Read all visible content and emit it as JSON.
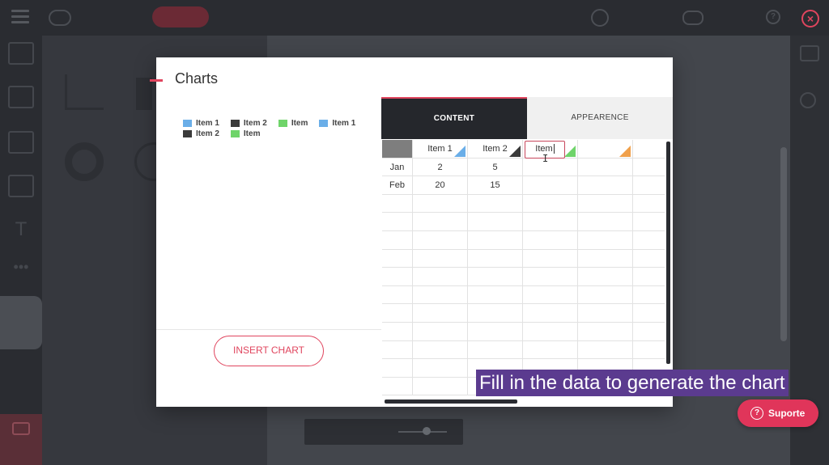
{
  "modal": {
    "title": "Charts",
    "insert_label": "INSERT CHART",
    "tabs": {
      "content": "CONTENT",
      "appearance": "APPEARENCE"
    }
  },
  "legend": [
    {
      "label": "Item 1",
      "color": "#6aaee8"
    },
    {
      "label": "Item 2",
      "color": "#3a3a3a"
    },
    {
      "label": "Item",
      "color": "#6fd46a"
    },
    {
      "label": "Item 1",
      "color": "#6aaee8"
    },
    {
      "label": "Item 2",
      "color": "#3a3a3a"
    },
    {
      "label": "Item",
      "color": "#6fd46a"
    }
  ],
  "sheet": {
    "headers": [
      "Item 1",
      "Item 2",
      "Item",
      ""
    ],
    "header_colors": [
      "#6aaee8",
      "#3a3a3a",
      "#6fd46a",
      "#f0a04b"
    ],
    "rows": [
      {
        "label": "Jan",
        "values": [
          "2",
          "5",
          "",
          ""
        ]
      },
      {
        "label": "Feb",
        "values": [
          "20",
          "15",
          "",
          ""
        ]
      }
    ],
    "editing_value": "Item"
  },
  "caption": "Fill in the data to generate the chart",
  "support_label": "Suporte",
  "colors": {
    "accent": "#e0455e",
    "caption_bg": "#5b3b8f"
  }
}
